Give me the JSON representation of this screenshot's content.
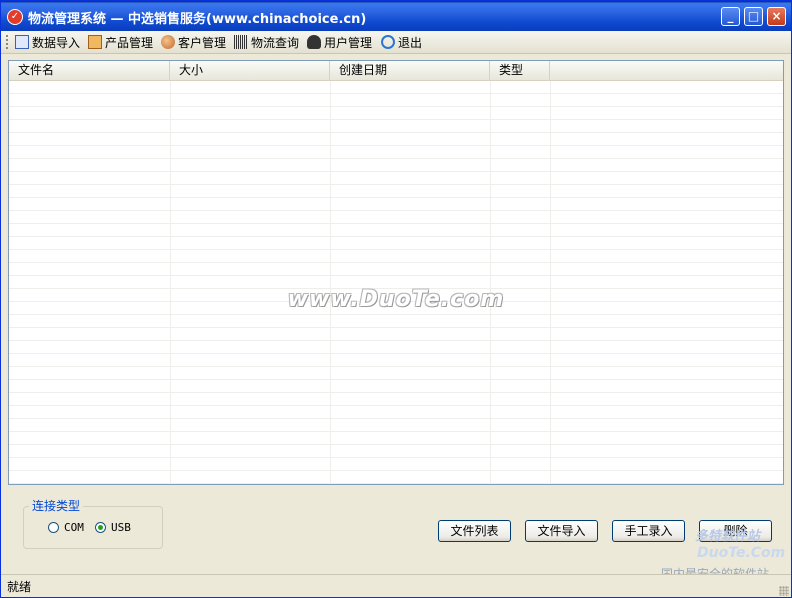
{
  "window": {
    "title": "物流管理系统 — 中选销售服务(www.chinachoice.cn)",
    "minimize_glyph": "_",
    "maximize_glyph": "□",
    "close_glyph": "×"
  },
  "toolbar": {
    "items": [
      {
        "label": "数据导入",
        "icon": "import-icon"
      },
      {
        "label": "产品管理",
        "icon": "product-icon"
      },
      {
        "label": "客户管理",
        "icon": "customers-icon"
      },
      {
        "label": "物流查询",
        "icon": "barcode-icon"
      },
      {
        "label": "用户管理",
        "icon": "user-icon"
      },
      {
        "label": "退出",
        "icon": "power-icon"
      }
    ]
  },
  "list": {
    "columns": [
      "文件名",
      "大小",
      "创建日期",
      "类型"
    ],
    "rows": []
  },
  "watermark": "www.DuoTe.com",
  "connection": {
    "legend": "连接类型",
    "options": [
      "COM",
      "USB"
    ],
    "selected": "USB"
  },
  "buttons": {
    "file_list": "文件列表",
    "file_import": "文件导入",
    "manual_entry": "手工录入",
    "delete": "删除"
  },
  "status": {
    "text": "就绪"
  },
  "corner_watermark": {
    "line1": "多特软件站",
    "line2": "DuoTe.Com",
    "line3": "国内最安全的软件站"
  },
  "colors": {
    "title_bar": "#2a62e0",
    "accent": "#0046d5",
    "radio_selected": "#21a121"
  }
}
